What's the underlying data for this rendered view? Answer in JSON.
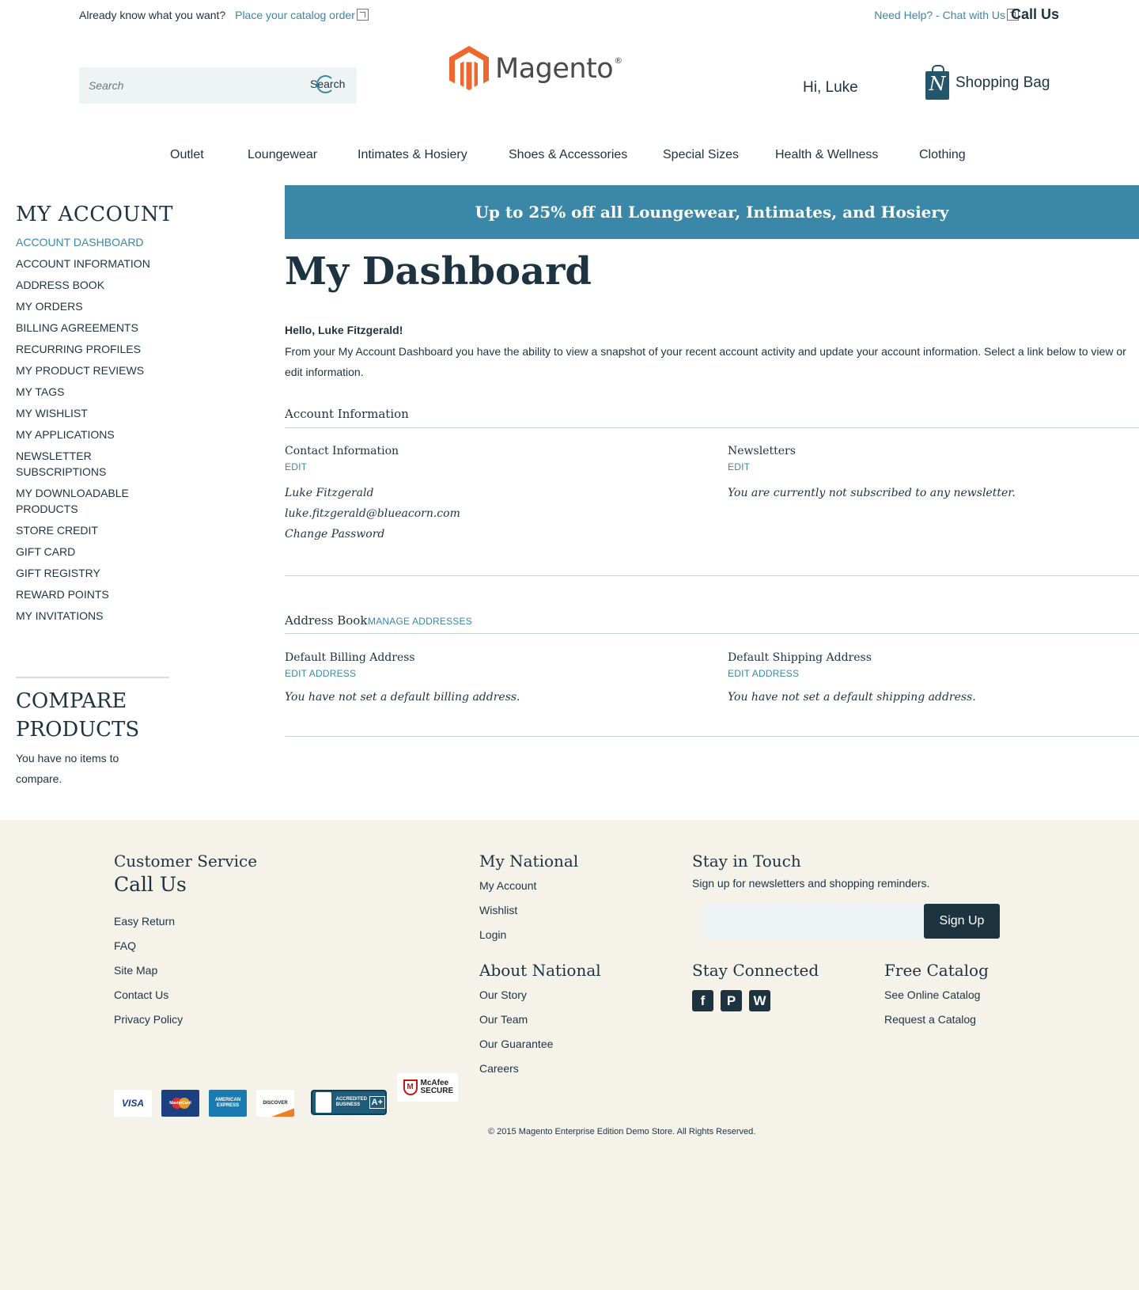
{
  "topbar": {
    "know_text": "Already know what you want?",
    "catalog_link": "Place your catalog order",
    "help_link": "Need Help? - Chat with Us",
    "call_us": "Call Us"
  },
  "header": {
    "search_placeholder": "Search",
    "search_button": "Search",
    "logo_text": "Magento",
    "logo_reg": "®",
    "greeting": "Hi, Luke",
    "bag_label": "Shopping Bag",
    "bag_letter": "N"
  },
  "nav": [
    "Outlet",
    "Loungewear",
    "Intimates & Hosiery",
    "Shoes & Accessories",
    "Special Sizes",
    "Health & Wellness",
    "Clothing"
  ],
  "sidebar": {
    "title": "MY ACCOUNT",
    "items": [
      {
        "label": "ACCOUNT DASHBOARD",
        "active": true
      },
      {
        "label": "ACCOUNT INFORMATION"
      },
      {
        "label": "ADDRESS BOOK"
      },
      {
        "label": "MY ORDERS"
      },
      {
        "label": "BILLING AGREEMENTS"
      },
      {
        "label": "RECURRING PROFILES"
      },
      {
        "label": "MY PRODUCT REVIEWS"
      },
      {
        "label": "MY TAGS"
      },
      {
        "label": "MY WISHLIST"
      },
      {
        "label": "MY APPLICATIONS"
      },
      {
        "label": "NEWSLETTER SUBSCRIPTIONS"
      },
      {
        "label": "MY DOWNLOADABLE PRODUCTS"
      },
      {
        "label": "STORE CREDIT"
      },
      {
        "label": "GIFT CARD"
      },
      {
        "label": "GIFT REGISTRY"
      },
      {
        "label": "REWARD POINTS"
      },
      {
        "label": "MY INVITATIONS"
      }
    ],
    "compare_title": "COMPARE PRODUCTS",
    "compare_text": "You have no items to compare."
  },
  "main": {
    "promo": "Up to 25% off all Loungewear, Intimates, and Hosiery",
    "title": "My Dashboard",
    "hello": "Hello, Luke Fitzgerald!",
    "intro": "From your My Account Dashboard you have the ability to view a snapshot of your recent account activity and update your account information. Select a link below to view or edit information.",
    "account_info": {
      "title": "Account Information",
      "contact_title": "Contact Information",
      "contact_edit": "EDIT",
      "name": "Luke Fitzgerald",
      "email": "luke.fitzgerald@blueacorn.com",
      "change_password": "Change Password",
      "newsletters_title": "Newsletters",
      "newsletters_edit": "EDIT",
      "newsletters_text": "You are currently not subscribed to any newsletter."
    },
    "address_book": {
      "title": "Address Book",
      "manage": "MANAGE ADDRESSES",
      "billing_title": "Default Billing Address",
      "billing_edit": "EDIT ADDRESS",
      "billing_text": "You have not set a default billing address.",
      "shipping_title": "Default Shipping Address",
      "shipping_edit": "EDIT ADDRESS",
      "shipping_text": "You have not set a default shipping address."
    }
  },
  "footer": {
    "cs_title": "Customer Service",
    "cs_call": "Call Us",
    "cs_links": [
      "Easy Return",
      "FAQ",
      "Site Map",
      "Contact Us",
      "Privacy Policy"
    ],
    "mynational_title": "My National",
    "mynational_links": [
      "My Account",
      "Wishlist",
      "Login"
    ],
    "about_title": "About National",
    "about_links": [
      "Our Story",
      "Our Team",
      "Our Guarantee",
      "Careers"
    ],
    "touch_title": "Stay in Touch",
    "touch_text": "Sign up for newsletters and shopping reminders.",
    "signup": "Sign Up",
    "connected_title": "Stay Connected",
    "catalog_title": "Free Catalog",
    "catalog_links": [
      "See Online Catalog",
      "Request a Catalog"
    ],
    "payments": [
      "VISA",
      "MasterCard",
      "AMERICAN EXPRESS",
      "DISCOVER"
    ],
    "bbb": "ACCREDITED BUSINESS",
    "bbb_rating": "A+",
    "mcafee": "McAfee SECURE",
    "copyright": "© 2015 Magento Enterprise Edition Demo Store. All Rights Reserved.",
    "colors": {
      "background": "#f5f2ea",
      "accent": "#3a87a7",
      "dark": "#1d3340"
    }
  }
}
